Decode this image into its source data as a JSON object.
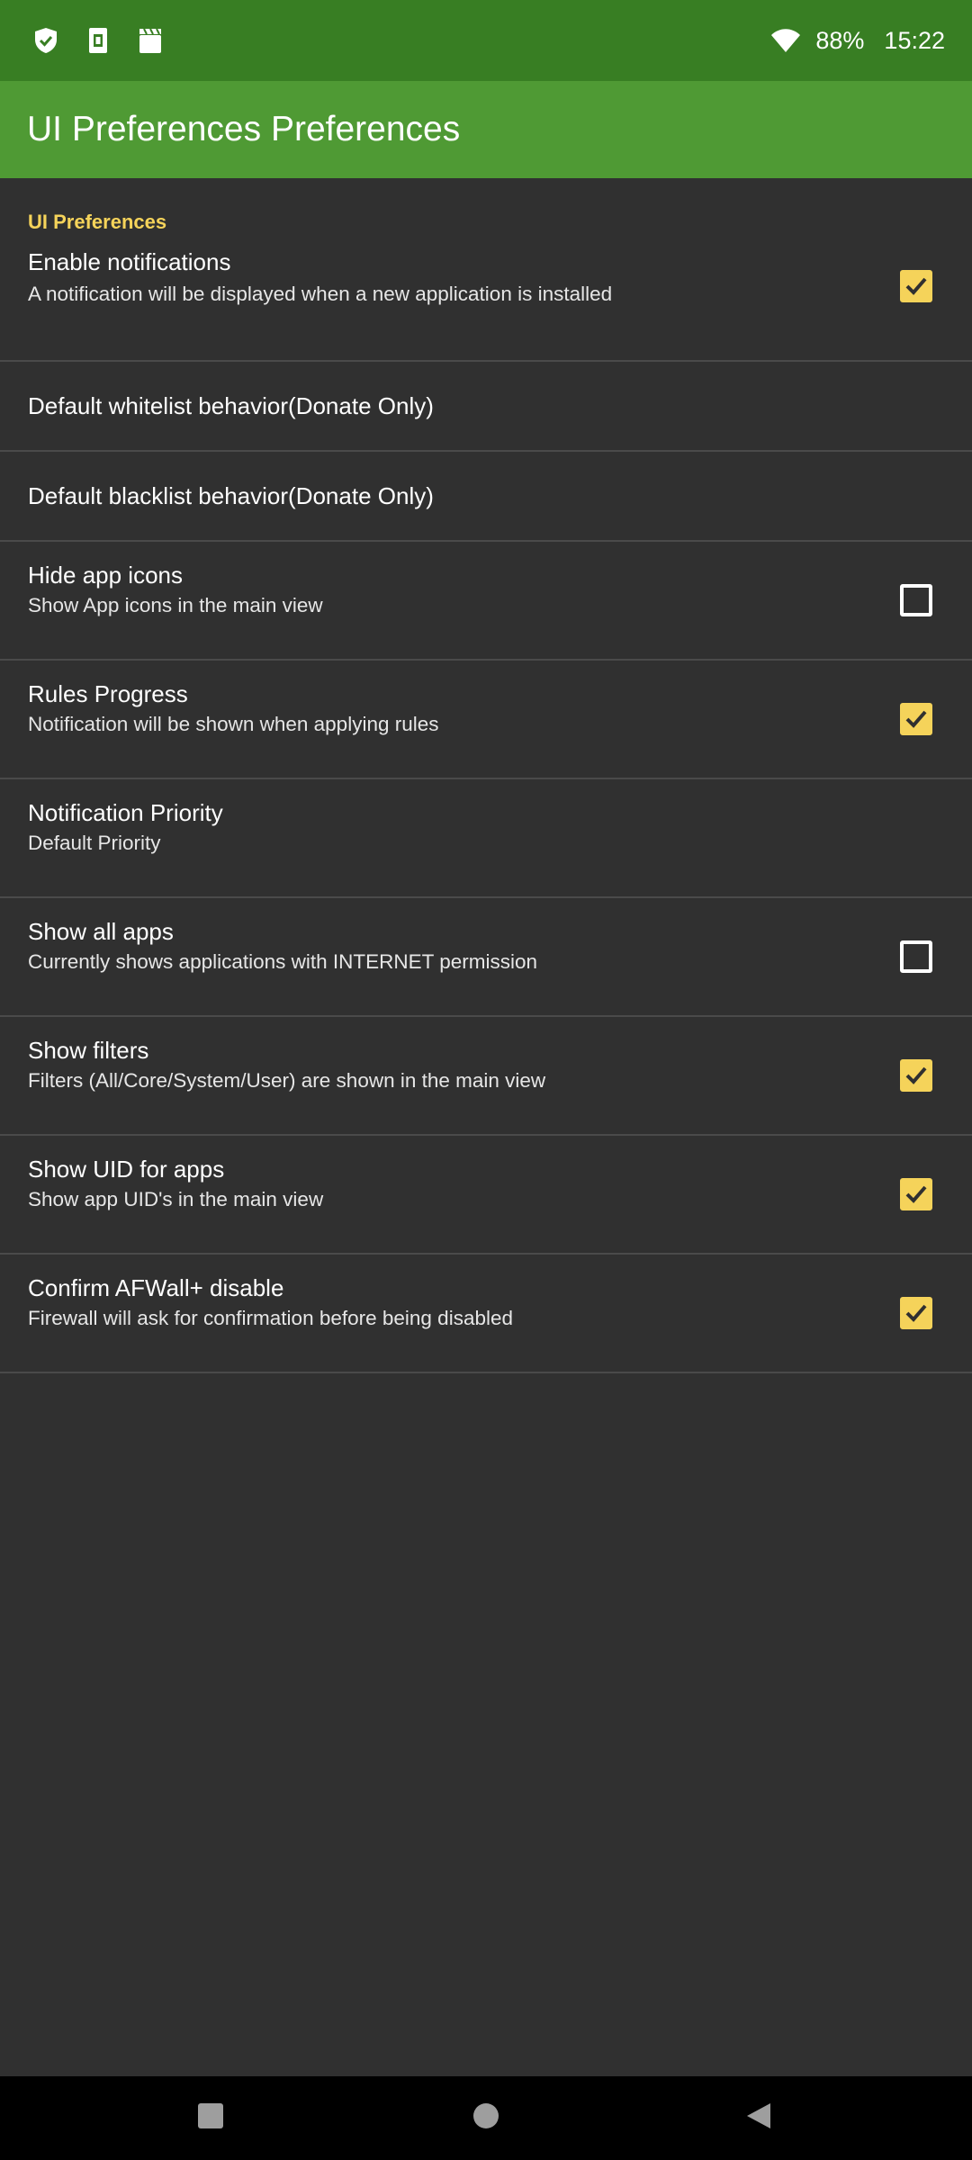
{
  "status_bar": {
    "left_icons": [
      "shield-check-icon",
      "sim-card-icon",
      "clapperboard-icon"
    ],
    "wifi_icon": "wifi-icon",
    "battery": "88%",
    "time": "15:22"
  },
  "app_bar": {
    "title": "UI Preferences Preferences"
  },
  "category": {
    "label": "UI Preferences"
  },
  "preferences": [
    {
      "title": "Enable notifications",
      "summary": "A notification will be displayed when a new application is installed",
      "checkbox": true,
      "checked": true
    },
    {
      "title": "Default whitelist behavior(Donate Only)",
      "summary": "",
      "checkbox": false
    },
    {
      "title": "Default blacklist behavior(Donate Only)",
      "summary": "",
      "checkbox": false
    },
    {
      "title": "Hide app icons",
      "summary": "Show App icons in the main view",
      "checkbox": true,
      "checked": false
    },
    {
      "title": "Rules Progress",
      "summary": "Notification will be shown when applying rules",
      "checkbox": true,
      "checked": true
    },
    {
      "title": "Notification Priority",
      "summary": "Default Priority",
      "checkbox": false
    },
    {
      "title": "Show all apps",
      "summary": "Currently shows applications with INTERNET permission",
      "checkbox": true,
      "checked": false
    },
    {
      "title": "Show filters",
      "summary": "Filters (All/Core/System/User) are shown in the main view",
      "checkbox": true,
      "checked": true
    },
    {
      "title": "Show UID for apps",
      "summary": "Show app UID's in the main view",
      "checkbox": true,
      "checked": true
    },
    {
      "title": "Confirm AFWall+ disable",
      "summary": "Firewall will ask for confirmation before being disabled",
      "checkbox": true,
      "checked": true
    }
  ],
  "nav_bar": {
    "buttons": [
      "recents-square-icon",
      "home-circle-icon",
      "back-triangle-icon"
    ]
  },
  "colors": {
    "status_bar": "#387e23",
    "app_bar": "#4f9a34",
    "accent": "#f5d35a",
    "background": "#303030",
    "divider": "#4a4a4a"
  }
}
